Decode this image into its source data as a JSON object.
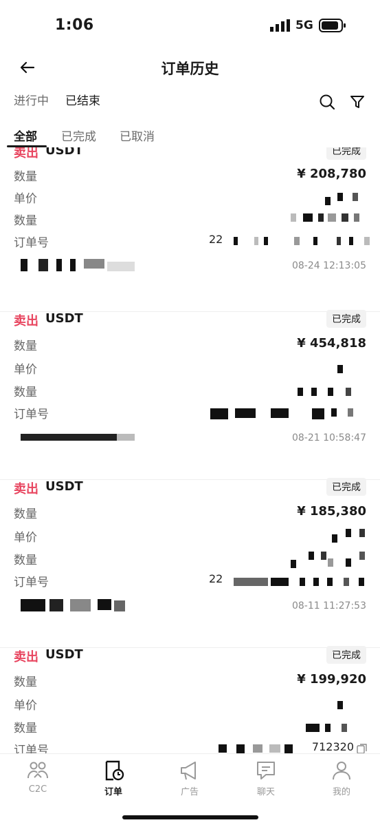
{
  "status": {
    "time": "1:06",
    "network": "5G"
  },
  "header": {
    "title": "订单历史"
  },
  "main_tabs": [
    {
      "label": "进行中",
      "active": false
    },
    {
      "label": "已结束",
      "active": true
    }
  ],
  "filter_tabs": [
    {
      "label": "全部",
      "active": true
    },
    {
      "label": "已完成",
      "active": false
    },
    {
      "label": "已取消",
      "active": false
    }
  ],
  "orders": [
    {
      "side": "卖出",
      "asset": "USDT",
      "status": "已完成",
      "amount_label": "数量",
      "amount": "¥ 208,780",
      "price_label": "单价",
      "quantity_label": "数量",
      "order_no_label": "订单号",
      "order_no_partial": "22",
      "time": "08-24 12:13:05"
    },
    {
      "side": "卖出",
      "asset": "USDT",
      "status": "已完成",
      "amount_label": "数量",
      "amount": "¥ 454,818",
      "price_label": "单价",
      "quantity_label": "数量",
      "order_no_label": "订单号",
      "order_no_partial": "",
      "time": "08-21 10:58:47"
    },
    {
      "side": "卖出",
      "asset": "USDT",
      "status": "已完成",
      "amount_label": "数量",
      "amount": "¥ 185,380",
      "price_label": "单价",
      "quantity_label": "数量",
      "order_no_label": "订单号",
      "order_no_partial": "22",
      "time": "08-11 11:27:53"
    },
    {
      "side": "卖出",
      "asset": "USDT",
      "status": "已完成",
      "amount_label": "数量",
      "amount": "¥ 199,920",
      "price_label": "单价",
      "quantity_label": "数量",
      "order_no_label": "订单号",
      "order_no_partial": "712320",
      "time": ""
    }
  ],
  "bottom_nav": [
    {
      "label": "C2C",
      "icon": "people-icon",
      "active": false
    },
    {
      "label": "订单",
      "icon": "order-clock-icon",
      "active": true
    },
    {
      "label": "广告",
      "icon": "megaphone-icon",
      "active": false
    },
    {
      "label": "聊天",
      "icon": "chat-icon",
      "active": false
    },
    {
      "label": "我的",
      "icon": "person-icon",
      "active": false
    }
  ],
  "colors": {
    "sell": "#e8455f",
    "text": "#1a1a1a",
    "muted": "#666666",
    "badge_bg": "#f2f2f2"
  }
}
